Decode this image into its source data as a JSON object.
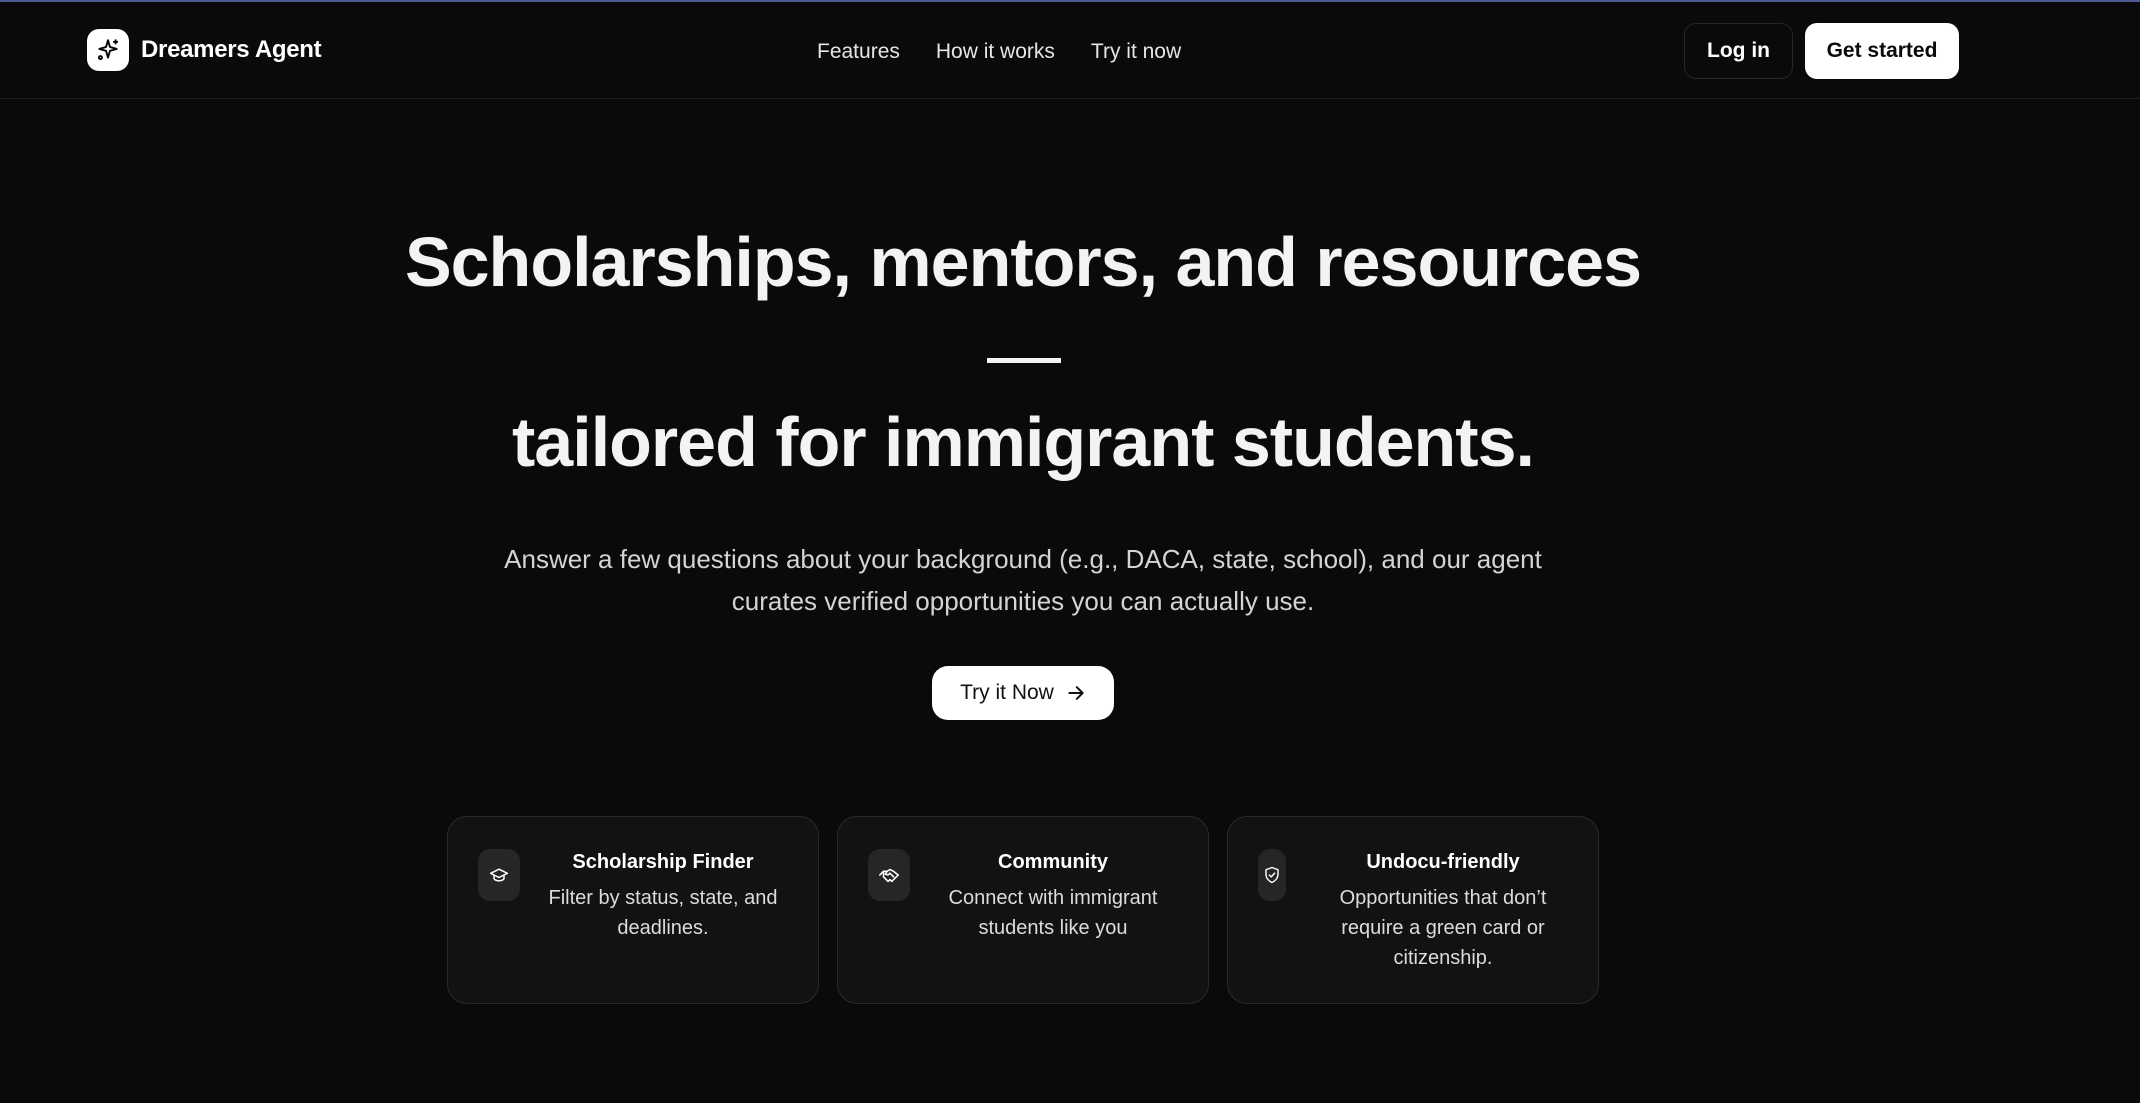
{
  "header": {
    "brand_name": "Dreamers Agent",
    "nav": [
      "Features",
      "How it works",
      "Try it now"
    ],
    "login_label": "Log in",
    "get_started_label": "Get started"
  },
  "hero": {
    "title_line1": "Scholarships, mentors, and resources",
    "title_line2": "tailored for immigrant students.",
    "subtitle": "Answer a few questions about your background (e.g., DACA, state, school), and our agent curates verified opportunities you can actually use.",
    "cta_label": "Try it Now"
  },
  "features": [
    {
      "title": "Scholarship Finder",
      "description": "Filter by status, state, and deadlines.",
      "icon": "graduation-cap-icon"
    },
    {
      "title": "Community",
      "description": "Connect with immigrant students like you",
      "icon": "handshake-icon"
    },
    {
      "title": "Undocu-friendly",
      "description": "Opportunities that don’t require a green card or citizenship.",
      "icon": "shield-check-icon"
    }
  ],
  "colors": {
    "background": "#0a0a0a",
    "accent_line": "#4f5b93",
    "card_bg": "#121212"
  }
}
